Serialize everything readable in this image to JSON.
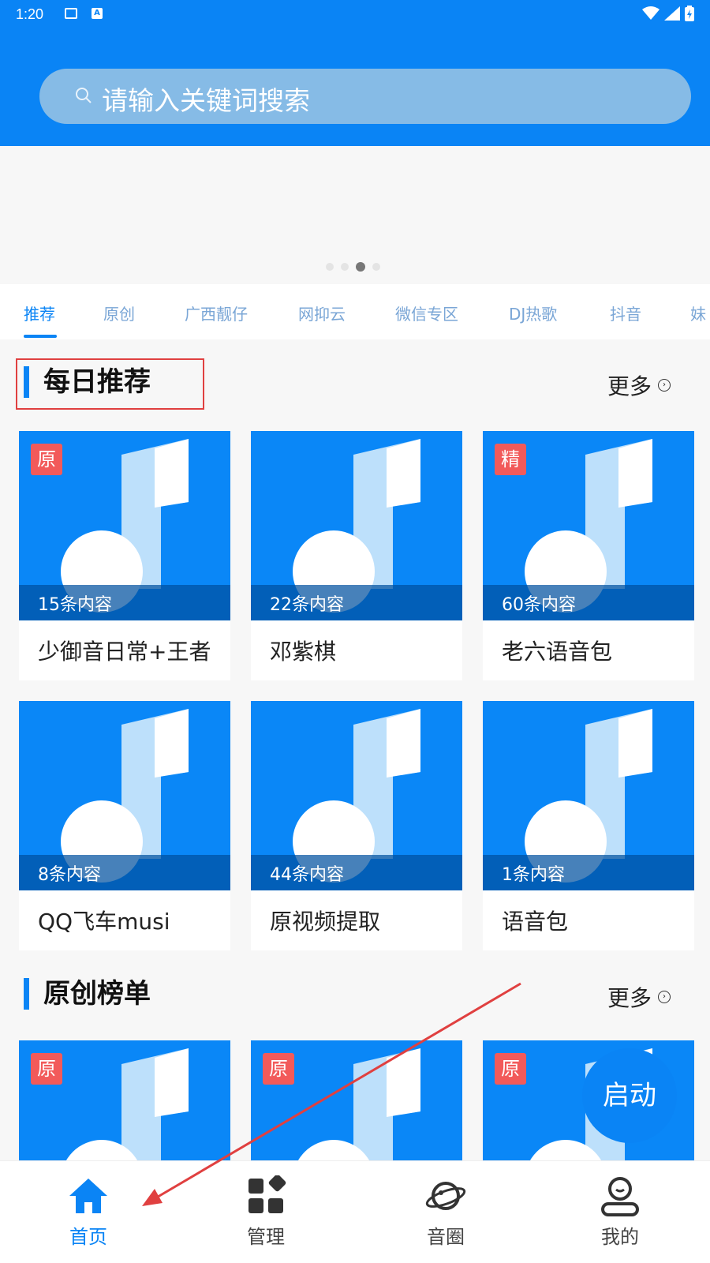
{
  "status_bar": {
    "time": "1:20"
  },
  "search": {
    "placeholder": "请输入关键词搜索"
  },
  "tabs": [
    {
      "label": "推荐",
      "active": true
    },
    {
      "label": "原创"
    },
    {
      "label": "广西靓仔"
    },
    {
      "label": "网抑云"
    },
    {
      "label": "微信专区"
    },
    {
      "label": "DJ热歌"
    },
    {
      "label": "抖音"
    },
    {
      "label": "妹"
    }
  ],
  "daily": {
    "title": "每日推荐",
    "more": "更多",
    "cards": [
      {
        "badge": "原",
        "count": "15条内容",
        "title": "少御音日常+王者"
      },
      {
        "badge": "",
        "count": "22条内容",
        "title": "邓紫棋"
      },
      {
        "badge": "精",
        "count": "60条内容",
        "title": "老六语音包"
      },
      {
        "badge": "",
        "count": "8条内容",
        "title": "QQ飞车musi"
      },
      {
        "badge": "",
        "count": "44条内容",
        "title": "原视频提取"
      },
      {
        "badge": "",
        "count": "1条内容",
        "title": "语音包"
      }
    ]
  },
  "ranking": {
    "title": "原创榜单",
    "more": "更多",
    "cards": [
      {
        "badge": "原"
      },
      {
        "badge": "原"
      },
      {
        "badge": "原"
      }
    ]
  },
  "fab": {
    "label": "启动"
  },
  "bottom_nav": [
    {
      "label": "首页",
      "icon": "home-icon",
      "active": true
    },
    {
      "label": "管理",
      "icon": "grid-icon"
    },
    {
      "label": "音圈",
      "icon": "planet-icon"
    },
    {
      "label": "我的",
      "icon": "user-icon"
    }
  ],
  "colors": {
    "primary": "#0a84f5",
    "badge": "#f25a5a",
    "annotation": "#e04040"
  }
}
